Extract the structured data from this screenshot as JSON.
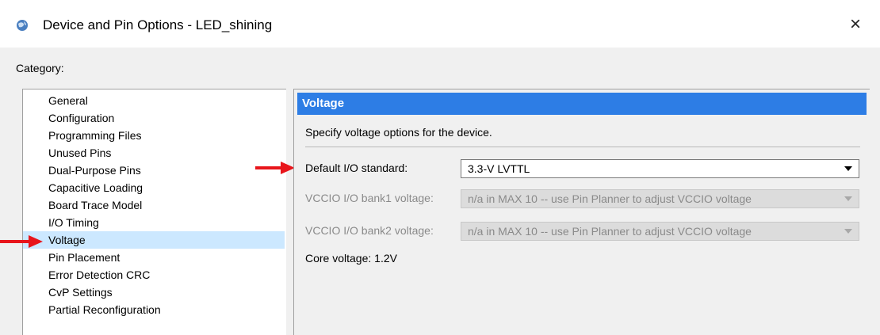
{
  "window": {
    "title": "Device and Pin Options - LED_shining",
    "close_glyph": "×"
  },
  "category_label": "Category:",
  "categories": [
    {
      "label": "General",
      "selected": false
    },
    {
      "label": "Configuration",
      "selected": false
    },
    {
      "label": "Programming Files",
      "selected": false
    },
    {
      "label": "Unused Pins",
      "selected": false
    },
    {
      "label": "Dual-Purpose Pins",
      "selected": false
    },
    {
      "label": "Capacitive Loading",
      "selected": false
    },
    {
      "label": "Board Trace Model",
      "selected": false
    },
    {
      "label": "I/O Timing",
      "selected": false
    },
    {
      "label": "Voltage",
      "selected": true
    },
    {
      "label": "Pin Placement",
      "selected": false
    },
    {
      "label": "Error Detection CRC",
      "selected": false
    },
    {
      "label": "CvP Settings",
      "selected": false
    },
    {
      "label": "Partial Reconfiguration",
      "selected": false
    }
  ],
  "panel": {
    "header": "Voltage",
    "description": "Specify voltage options for the device.",
    "default_io": {
      "label": "Default I/O standard:",
      "value": "3.3-V LVTTL"
    },
    "bank1": {
      "label": "VCCIO I/O bank1 voltage:",
      "value": "n/a in MAX 10 -- use Pin Planner to adjust VCCIO voltage"
    },
    "bank2": {
      "label": "VCCIO I/O bank2 voltage:",
      "value": "n/a in MAX 10 -- use Pin Planner to adjust VCCIO voltage"
    },
    "core_voltage": "Core voltage: 1.2V"
  },
  "colors": {
    "header_blue": "#2d7de5",
    "selection": "#cce8ff",
    "annotation_arrow": "#e8151b"
  }
}
